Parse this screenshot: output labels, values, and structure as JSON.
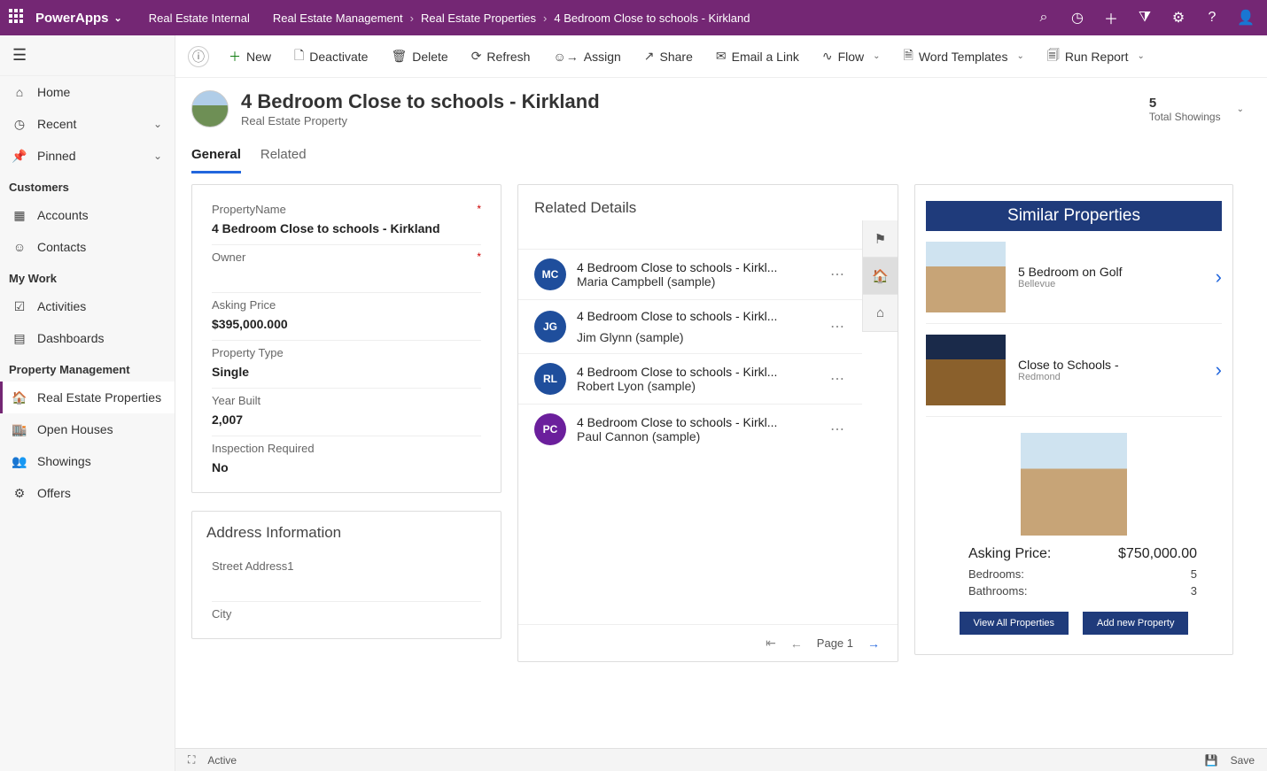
{
  "topbar": {
    "brand": "PowerApps",
    "crumbs": [
      "Real Estate Internal",
      "Real Estate Management",
      "Real Estate Properties",
      "4 Bedroom Close to schools - Kirkland"
    ]
  },
  "sidebar": {
    "home": "Home",
    "recent": "Recent",
    "pinned": "Pinned",
    "groups": [
      {
        "title": "Customers",
        "items": [
          {
            "icon": "building",
            "label": "Accounts"
          },
          {
            "icon": "person",
            "label": "Contacts"
          }
        ]
      },
      {
        "title": "My Work",
        "items": [
          {
            "icon": "check",
            "label": "Activities"
          },
          {
            "icon": "dash",
            "label": "Dashboards"
          }
        ]
      },
      {
        "title": "Property Management",
        "items": [
          {
            "icon": "house",
            "label": "Real Estate Properties",
            "active": true
          },
          {
            "icon": "store",
            "label": "Open Houses"
          },
          {
            "icon": "people",
            "label": "Showings"
          },
          {
            "icon": "gear",
            "label": "Offers"
          }
        ]
      }
    ]
  },
  "commands": {
    "new": "New",
    "deactivate": "Deactivate",
    "delete": "Delete",
    "refresh": "Refresh",
    "assign": "Assign",
    "share": "Share",
    "email": "Email a Link",
    "flow": "Flow",
    "wordtpl": "Word Templates",
    "runreport": "Run Report"
  },
  "record": {
    "title": "4 Bedroom Close to schools - Kirkland",
    "subtitle": "Real Estate Property",
    "showings_count": "5",
    "showings_label": "Total Showings"
  },
  "tabs": {
    "general": "General",
    "related": "Related"
  },
  "form": {
    "propname_label": "PropertyName",
    "propname_value": "4 Bedroom Close to schools - Kirkland",
    "owner_label": "Owner",
    "owner_value": "",
    "price_label": "Asking Price",
    "price_value": "$395,000.000",
    "type_label": "Property Type",
    "type_value": "Single",
    "year_label": "Year Built",
    "year_value": "2,007",
    "insp_label": "Inspection Required",
    "insp_value": "No"
  },
  "address_section": "Address Information",
  "address": {
    "street_label": "Street Address1",
    "city_label": "City"
  },
  "related": {
    "title": "Related Details",
    "items": [
      {
        "initials": "MC",
        "color": "blue",
        "line1": "4 Bedroom Close to schools - Kirkl...",
        "line2": "Maria Campbell (sample)"
      },
      {
        "initials": "JG",
        "color": "blue",
        "line1": "4 Bedroom Close to schools - Kirkl...",
        "line2": "Jim Glynn (sample)"
      },
      {
        "initials": "RL",
        "color": "blue",
        "line1": "4 Bedroom Close to schools - Kirkl...",
        "line2": "Robert Lyon (sample)"
      },
      {
        "initials": "PC",
        "color": "purple",
        "line1": "4 Bedroom Close to schools - Kirkl...",
        "line2": "Paul Cannon (sample)"
      }
    ],
    "page": "Page 1"
  },
  "similar": {
    "title": "Similar Properties",
    "items": [
      {
        "title": "5 Bedroom on Golf",
        "sub": "Bellevue"
      },
      {
        "title": "Close to Schools -",
        "sub": "Redmond"
      }
    ],
    "asking_label": "Asking Price:",
    "asking_value": "$750,000.00",
    "beds_label": "Bedrooms:",
    "beds_value": "5",
    "baths_label": "Bathrooms:",
    "baths_value": "3",
    "btn_all": "View All Properties",
    "btn_add": "Add new Property"
  },
  "status": {
    "active": "Active",
    "save": "Save"
  }
}
